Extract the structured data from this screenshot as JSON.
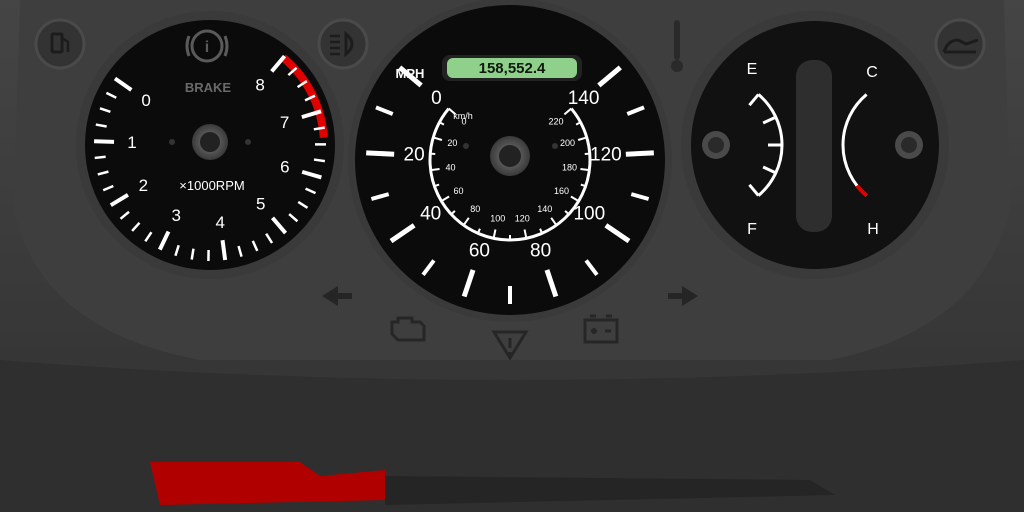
{
  "tachometer": {
    "brake_label": "BRAKE",
    "unit_label": "×1000RPM",
    "labels": [
      "0",
      "1",
      "2",
      "3",
      "4",
      "5",
      "6",
      "7",
      "8"
    ],
    "redline_from": 6.6,
    "max": 8
  },
  "speedometer": {
    "odometer": "158,552.4",
    "mph_label": "MPH",
    "kmh_label": "km/h",
    "mph_labels": [
      "0",
      "20",
      "40",
      "60",
      "80",
      "100",
      "120",
      "140"
    ],
    "kmh_labels": [
      "0",
      "20",
      "40",
      "60",
      "80",
      "100",
      "120",
      "140",
      "160",
      "180",
      "200",
      "220"
    ],
    "max_mph": 140
  },
  "fuel_gauge": {
    "empty_label": "E",
    "full_label": "F"
  },
  "temp_gauge": {
    "cold_label": "C",
    "hot_label": "H"
  },
  "indicators": {
    "fuel": "fuel-pump-icon",
    "brake": "brake-warning-icon",
    "headlight": "headlight-icon",
    "door": "door-open-icon",
    "engine": "check-engine-icon",
    "warning": "hazard-warning-icon",
    "battery": "battery-icon",
    "left_turn": "left-turn-arrow-icon",
    "right_turn": "right-turn-arrow-icon"
  },
  "colors": {
    "face": "#0b0b0b",
    "marking": "#ffffff",
    "redline": "#e00000",
    "lcd": "#8fd18a",
    "bezel": "#3c3c3c",
    "red_strip": "#b10000"
  }
}
